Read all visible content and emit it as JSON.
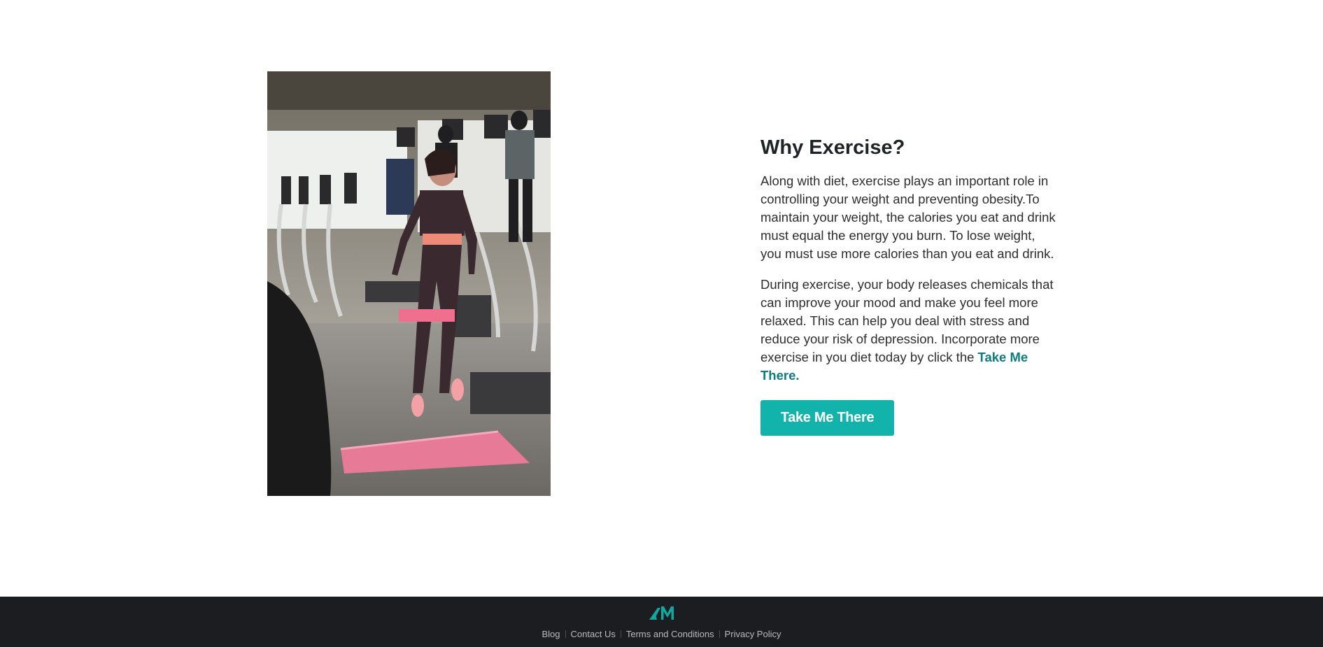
{
  "hero_image": {
    "icon": "gym-photo"
  },
  "article": {
    "heading": "Why Exercise?",
    "paragraph_1": "Along with diet, exercise plays an important role in controlling your weight and preventing obesity.To maintain your weight, the calories you eat and drink must equal the energy you burn. To lose weight, you must use more calories than you eat and drink.",
    "paragraph_2_text": "During exercise, your body releases chemicals that can improve your mood and make you feel more relaxed. This can help you deal with stress and reduce your risk of depression. Incorporate more exercise in you diet today by click the ",
    "paragraph_2_link": "Take Me There.",
    "cta_label": "Take Me There",
    "accent_color": "#11b3ab",
    "link_color": "#0e7c7f"
  },
  "footer": {
    "logo_icon": "am-logo-icon",
    "links": {
      "blog": "Blog",
      "contact": "Contact Us",
      "terms": "Terms and Conditions",
      "privacy": "Privacy Policy"
    },
    "background": "#1c1d20"
  }
}
